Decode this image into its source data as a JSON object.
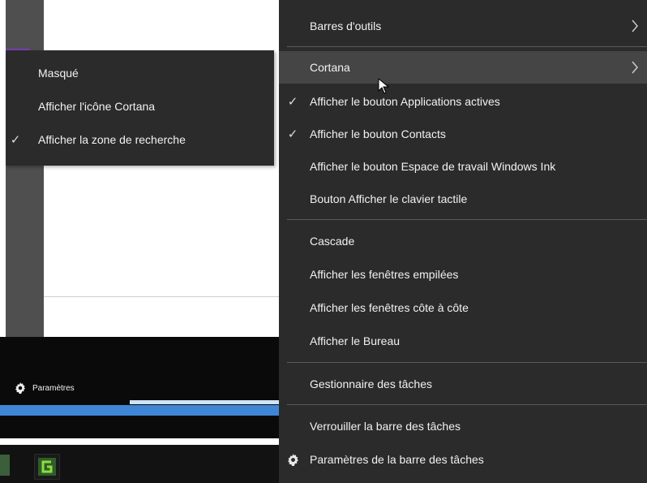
{
  "submenu": {
    "items": [
      {
        "label": "Masqué",
        "checked": false
      },
      {
        "label": "Afficher l'icône Cortana",
        "checked": false
      },
      {
        "label": "Afficher la zone de recherche",
        "checked": true
      }
    ]
  },
  "main_menu": {
    "items": [
      {
        "label": "Barres d'outils",
        "submenu": true
      },
      {
        "label": "Cortana",
        "submenu": true,
        "highlighted": true
      },
      {
        "label": "Afficher le bouton Applications actives",
        "checked": true
      },
      {
        "label": "Afficher le bouton Contacts",
        "checked": true
      },
      {
        "label": "Afficher le bouton Espace de travail Windows Ink"
      },
      {
        "label": "Bouton Afficher le clavier tactile"
      },
      {
        "label": "Cascade"
      },
      {
        "label": "Afficher les fenêtres empilées"
      },
      {
        "label": "Afficher les fenêtres côte à côte"
      },
      {
        "label": "Afficher le Bureau"
      },
      {
        "label": "Gestionnaire des tâches"
      },
      {
        "label": "Verrouiller la barre des tâches"
      },
      {
        "label": "Paramètres de la barre des tâches",
        "icon": "gear-icon"
      }
    ]
  },
  "background": {
    "settings_label": "Paramètres",
    "settings_icon": "gear-icon"
  },
  "check_glyph": "✓",
  "colors": {
    "menu_bg": "#2b2b2b",
    "menu_highlight": "#454545",
    "menu_text": "#f2f2f2",
    "accent_blue": "#3f86d6",
    "accent_purple": "#7a3fb5"
  }
}
